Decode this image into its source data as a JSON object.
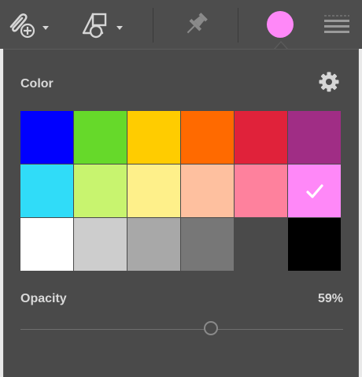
{
  "toolbar": {
    "buttons": [
      {
        "name": "attach-add-icon"
      },
      {
        "name": "shapes-icon"
      },
      {
        "name": "pin-icon"
      },
      {
        "name": "color-picker-button"
      },
      {
        "name": "menu-icon"
      }
    ],
    "current_color": "#ff88f8"
  },
  "panel": {
    "color_label": "Color",
    "opacity_label": "Opacity",
    "opacity_value": "59%",
    "opacity_fraction": 0.59
  },
  "swatches": [
    [
      "#0000ff",
      "#66d92a",
      "#ffcc00",
      "#ff6a00",
      "#e0223a",
      "#a02d85"
    ],
    [
      "#30dcf8",
      "#c8f46f",
      "#fef08a",
      "#fec09f",
      "#fe819d",
      "#ff88f8"
    ],
    [
      "#ffffff",
      "#cdcdcd",
      "#a8a8a8",
      "#777777",
      "#4a4a4a",
      "#000000"
    ]
  ],
  "selected_swatch": "#ff88f8"
}
